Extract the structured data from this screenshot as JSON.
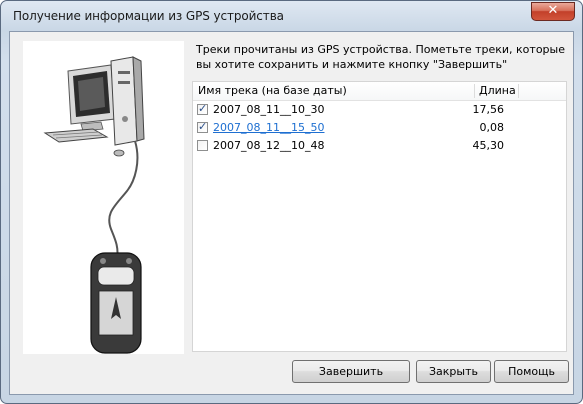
{
  "window": {
    "title": "Получение информации из GPS устройства"
  },
  "instruction": "Треки прочитаны из GPS устройства. Пометьте треки, которые вы хотите сохранить и нажмите кнопку \"Завершить\"",
  "list": {
    "columns": {
      "name": "Имя трека (на базе даты)",
      "length": "Длина"
    },
    "rows": [
      {
        "name": "2007_08_11__10_30",
        "length": "17,56",
        "checked": true,
        "highlighted": false
      },
      {
        "name": "2007_08_11__15_50",
        "length": "0,08",
        "checked": true,
        "highlighted": true
      },
      {
        "name": "2007_08_12__10_48",
        "length": "45,30",
        "checked": false,
        "highlighted": false
      }
    ]
  },
  "buttons": {
    "finish": "Завершить",
    "close": "Закрыть",
    "help": "Помощь"
  },
  "colors": {
    "link": "#1e6fd1",
    "close_button": "#c2402a"
  }
}
